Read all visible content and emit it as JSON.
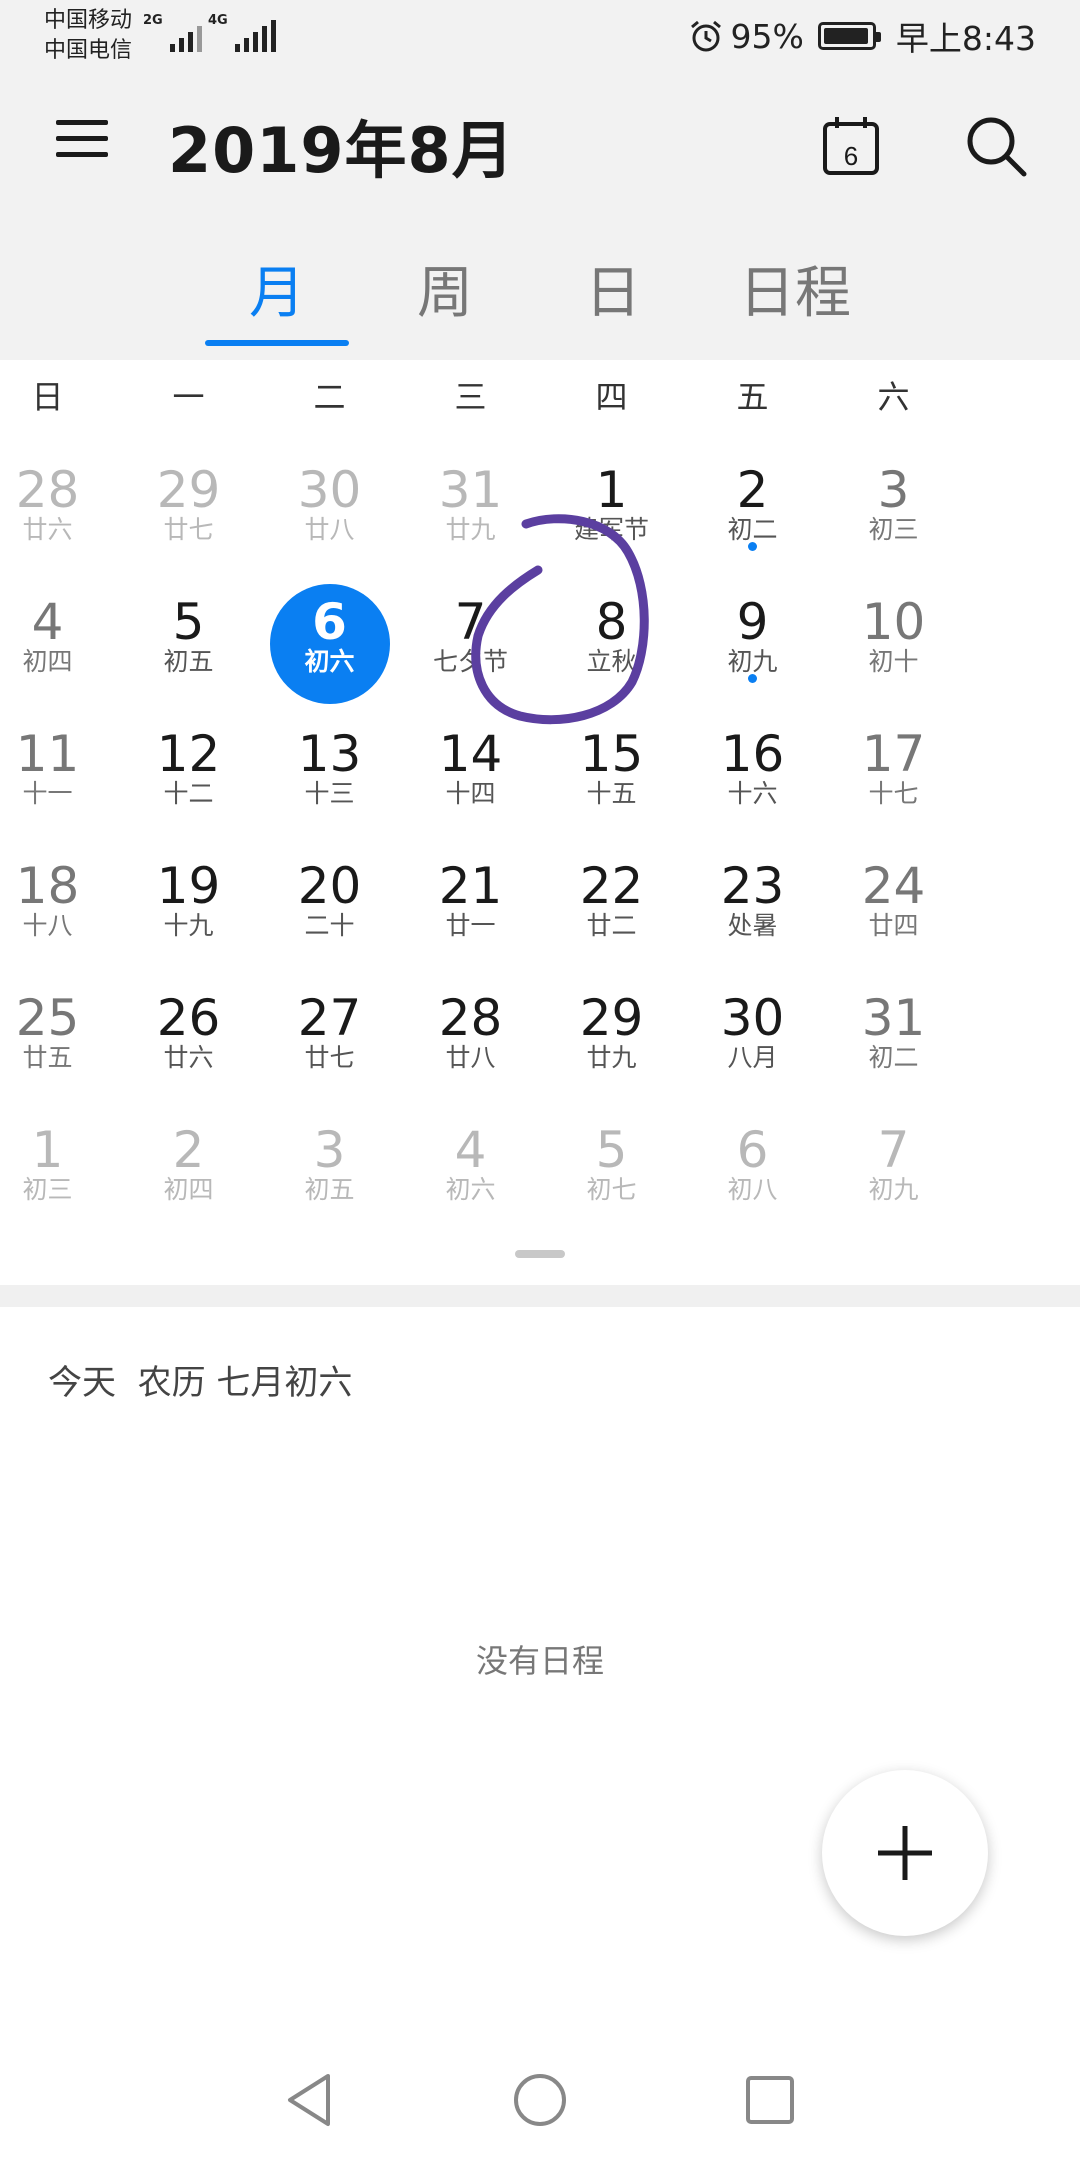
{
  "status_bar": {
    "carrier_1": "中国移动",
    "carrier_2": "中国电信",
    "signal_1_type": "2G",
    "signal_2_type": "4G",
    "battery": "95%",
    "time": "早上8:43"
  },
  "app_bar": {
    "title": "2019年8月",
    "today_icon_day": "6"
  },
  "tabs": [
    {
      "label": "月",
      "active": true
    },
    {
      "label": "周",
      "active": false
    },
    {
      "label": "日",
      "active": false
    },
    {
      "label": "日程",
      "active": false
    }
  ],
  "weekdays": [
    "日",
    "一",
    "二",
    "三",
    "四",
    "五",
    "六"
  ],
  "weeks": [
    [
      {
        "n": "28",
        "l": "廿六",
        "other": true
      },
      {
        "n": "29",
        "l": "廿七",
        "other": true
      },
      {
        "n": "30",
        "l": "廿八",
        "other": true
      },
      {
        "n": "31",
        "l": "廿九",
        "other": true
      },
      {
        "n": "1",
        "l": "建军节"
      },
      {
        "n": "2",
        "l": "初二",
        "dot": true
      },
      {
        "n": "3",
        "l": "初三"
      }
    ],
    [
      {
        "n": "4",
        "l": "初四"
      },
      {
        "n": "5",
        "l": "初五"
      },
      {
        "n": "6",
        "l": "初六",
        "selected": true
      },
      {
        "n": "7",
        "l": "七夕节"
      },
      {
        "n": "8",
        "l": "立秋"
      },
      {
        "n": "9",
        "l": "初九",
        "dot": true
      },
      {
        "n": "10",
        "l": "初十"
      }
    ],
    [
      {
        "n": "11",
        "l": "十一"
      },
      {
        "n": "12",
        "l": "十二"
      },
      {
        "n": "13",
        "l": "十三"
      },
      {
        "n": "14",
        "l": "十四"
      },
      {
        "n": "15",
        "l": "十五"
      },
      {
        "n": "16",
        "l": "十六"
      },
      {
        "n": "17",
        "l": "十七"
      }
    ],
    [
      {
        "n": "18",
        "l": "十八"
      },
      {
        "n": "19",
        "l": "十九"
      },
      {
        "n": "20",
        "l": "二十"
      },
      {
        "n": "21",
        "l": "廿一"
      },
      {
        "n": "22",
        "l": "廿二"
      },
      {
        "n": "23",
        "l": "处暑"
      },
      {
        "n": "24",
        "l": "廿四"
      }
    ],
    [
      {
        "n": "25",
        "l": "廿五"
      },
      {
        "n": "26",
        "l": "廿六"
      },
      {
        "n": "27",
        "l": "廿七"
      },
      {
        "n": "28",
        "l": "廿八"
      },
      {
        "n": "29",
        "l": "廿九"
      },
      {
        "n": "30",
        "l": "八月"
      },
      {
        "n": "31",
        "l": "初二"
      }
    ],
    [
      {
        "n": "1",
        "l": "初三",
        "other": true
      },
      {
        "n": "2",
        "l": "初四",
        "other": true
      },
      {
        "n": "3",
        "l": "初五",
        "other": true
      },
      {
        "n": "4",
        "l": "初六",
        "other": true
      },
      {
        "n": "5",
        "l": "初七",
        "other": true
      },
      {
        "n": "6",
        "l": "初八",
        "other": true
      },
      {
        "n": "7",
        "l": "初九",
        "other": true
      }
    ]
  ],
  "agenda": {
    "today_label": "今天  农历 七月初六",
    "empty_text": "没有日程"
  },
  "colors": {
    "accent": "#0a7ff2",
    "annotation": "#5b3fa0"
  },
  "icons": [
    "menu-icon",
    "today-calendar-icon",
    "search-icon",
    "add-icon",
    "back-icon",
    "home-icon",
    "recents-icon",
    "alarm-icon",
    "battery-icon",
    "signal-icon"
  ]
}
